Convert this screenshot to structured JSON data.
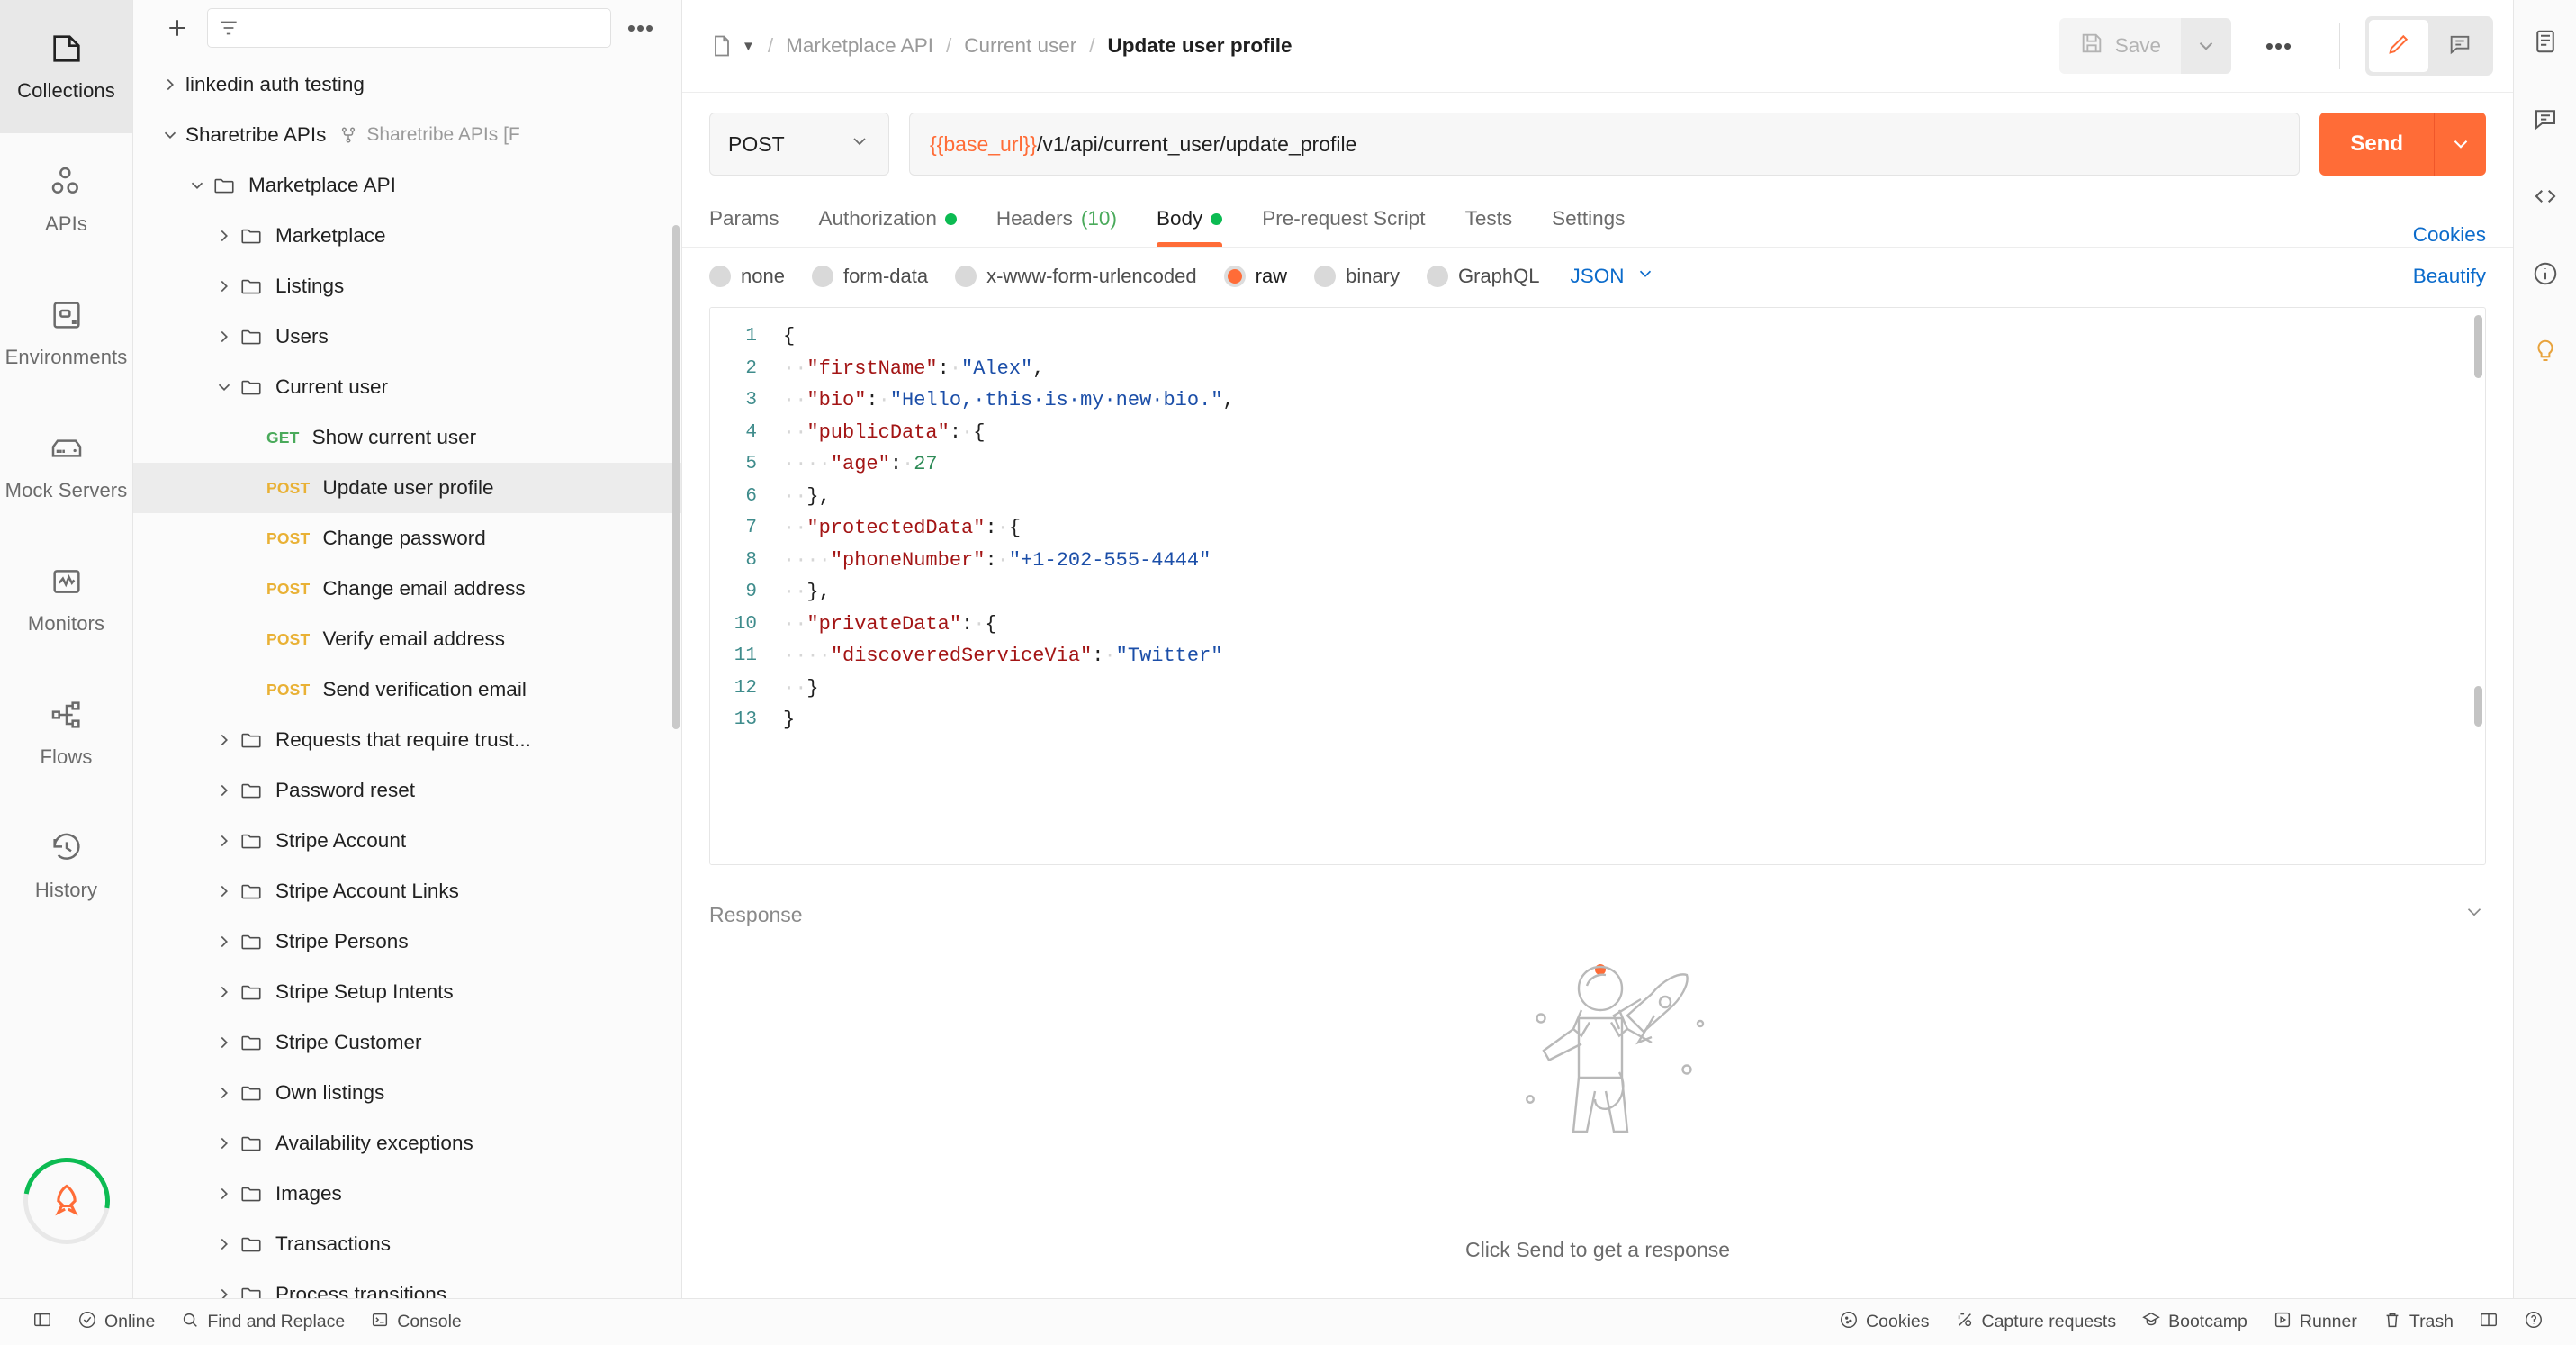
{
  "left_rail": {
    "items": [
      {
        "label": "Collections",
        "icon": "collections-icon",
        "active": true
      },
      {
        "label": "APIs",
        "icon": "apis-icon",
        "active": false
      },
      {
        "label": "Environments",
        "icon": "environments-icon",
        "active": false
      },
      {
        "label": "Mock Servers",
        "icon": "mock-servers-icon",
        "active": false
      },
      {
        "label": "Monitors",
        "icon": "monitors-icon",
        "active": false
      },
      {
        "label": "Flows",
        "icon": "flows-icon",
        "active": false
      },
      {
        "label": "History",
        "icon": "history-icon",
        "active": false
      }
    ],
    "badge_icon": "rocket-icon",
    "badge_ring_color": "#0cbb52"
  },
  "sidebar": {
    "new_button_icon": "plus-icon",
    "filter_icon": "filter-icon",
    "search_placeholder": "",
    "search_value": "",
    "more_icon": "ellipsis-icon",
    "tree": [
      {
        "label": "linkedin auth testing",
        "type": "collection",
        "depth": 0,
        "expanded": false
      },
      {
        "label": "Sharetribe APIs",
        "type": "collection",
        "depth": 0,
        "expanded": true,
        "fork_icon": "fork-icon",
        "fork_label": "Sharetribe APIs [F"
      },
      {
        "label": "Marketplace API",
        "type": "folder",
        "depth": 1,
        "expanded": true
      },
      {
        "label": "Marketplace",
        "type": "folder",
        "depth": 2,
        "expanded": false
      },
      {
        "label": "Listings",
        "type": "folder",
        "depth": 2,
        "expanded": false
      },
      {
        "label": "Users",
        "type": "folder",
        "depth": 2,
        "expanded": false
      },
      {
        "label": "Current user",
        "type": "folder",
        "depth": 2,
        "expanded": true
      },
      {
        "label": "Show current user",
        "type": "request",
        "depth": 3,
        "method": "GET"
      },
      {
        "label": "Update user profile",
        "type": "request",
        "depth": 3,
        "method": "POST",
        "selected": true
      },
      {
        "label": "Change password",
        "type": "request",
        "depth": 3,
        "method": "POST"
      },
      {
        "label": "Change email address",
        "type": "request",
        "depth": 3,
        "method": "POST"
      },
      {
        "label": "Verify email address",
        "type": "request",
        "depth": 3,
        "method": "POST"
      },
      {
        "label": "Send verification email",
        "type": "request",
        "depth": 3,
        "method": "POST"
      },
      {
        "label": "Requests that require trust...",
        "type": "folder",
        "depth": 2,
        "expanded": false
      },
      {
        "label": "Password reset",
        "type": "folder",
        "depth": 2,
        "expanded": false
      },
      {
        "label": "Stripe Account",
        "type": "folder",
        "depth": 2,
        "expanded": false
      },
      {
        "label": "Stripe Account Links",
        "type": "folder",
        "depth": 2,
        "expanded": false
      },
      {
        "label": "Stripe Persons",
        "type": "folder",
        "depth": 2,
        "expanded": false
      },
      {
        "label": "Stripe Setup Intents",
        "type": "folder",
        "depth": 2,
        "expanded": false
      },
      {
        "label": "Stripe Customer",
        "type": "folder",
        "depth": 2,
        "expanded": false
      },
      {
        "label": "Own listings",
        "type": "folder",
        "depth": 2,
        "expanded": false
      },
      {
        "label": "Availability exceptions",
        "type": "folder",
        "depth": 2,
        "expanded": false
      },
      {
        "label": "Images",
        "type": "folder",
        "depth": 2,
        "expanded": false
      },
      {
        "label": "Transactions",
        "type": "folder",
        "depth": 2,
        "expanded": false
      },
      {
        "label": "Process transitions",
        "type": "folder",
        "depth": 2,
        "expanded": false
      }
    ]
  },
  "topbar": {
    "doc_icon": "document-icon",
    "breadcrumb": [
      {
        "label": "Marketplace API",
        "current": false
      },
      {
        "label": "Current user",
        "current": false
      },
      {
        "label": "Update user profile",
        "current": true
      }
    ],
    "separator": "/",
    "save_label": "Save",
    "save_icon": "save-icon",
    "save_caret_icon": "chevron-down-icon",
    "more_icon": "ellipsis-icon",
    "view_buttons": [
      {
        "icon": "pencil-icon",
        "active": true
      },
      {
        "icon": "comment-icon",
        "active": false
      }
    ]
  },
  "request": {
    "method": "POST",
    "url_variable": "{{base_url}}",
    "url_path": "/v1/api/current_user/update_profile",
    "send_label": "Send",
    "send_caret_icon": "chevron-down-icon",
    "accent_color": "#ff6c37"
  },
  "tabs": {
    "items": [
      {
        "label": "Params",
        "active": false,
        "dot": false
      },
      {
        "label": "Authorization",
        "active": false,
        "dot": true
      },
      {
        "label": "Headers",
        "active": false,
        "dot": false,
        "count": "(10)"
      },
      {
        "label": "Body",
        "active": true,
        "dot": true
      },
      {
        "label": "Pre-request Script",
        "active": false,
        "dot": false
      },
      {
        "label": "Tests",
        "active": false,
        "dot": false
      },
      {
        "label": "Settings",
        "active": false,
        "dot": false
      }
    ],
    "cookies_label": "Cookies"
  },
  "body_bar": {
    "options": [
      {
        "label": "none",
        "selected": false
      },
      {
        "label": "form-data",
        "selected": false
      },
      {
        "label": "x-www-form-urlencoded",
        "selected": false
      },
      {
        "label": "raw",
        "selected": true
      },
      {
        "label": "binary",
        "selected": false
      },
      {
        "label": "GraphQL",
        "selected": false
      }
    ],
    "format": "JSON",
    "format_caret_icon": "chevron-down-icon",
    "beautify_label": "Beautify"
  },
  "editor": {
    "line_numbers": [
      "1",
      "2",
      "3",
      "4",
      "5",
      "6",
      "7",
      "8",
      "9",
      "10",
      "11",
      "12",
      "13"
    ],
    "lines": [
      [
        {
          "t": "{",
          "c": "p"
        }
      ],
      [
        {
          "t": "··",
          "c": "ws"
        },
        {
          "t": "\"firstName\"",
          "c": "k"
        },
        {
          "t": ":",
          "c": "p"
        },
        {
          "t": "·",
          "c": "ws"
        },
        {
          "t": "\"Alex\"",
          "c": "s"
        },
        {
          "t": ",",
          "c": "p"
        }
      ],
      [
        {
          "t": "··",
          "c": "ws"
        },
        {
          "t": "\"bio\"",
          "c": "k"
        },
        {
          "t": ":",
          "c": "p"
        },
        {
          "t": "·",
          "c": "ws"
        },
        {
          "t": "\"Hello,·this·is·my·new·bio.\"",
          "c": "s"
        },
        {
          "t": ",",
          "c": "p"
        }
      ],
      [
        {
          "t": "··",
          "c": "ws"
        },
        {
          "t": "\"publicData\"",
          "c": "k"
        },
        {
          "t": ":",
          "c": "p"
        },
        {
          "t": "·",
          "c": "ws"
        },
        {
          "t": "{",
          "c": "p"
        }
      ],
      [
        {
          "t": "····",
          "c": "ws"
        },
        {
          "t": "\"age\"",
          "c": "k"
        },
        {
          "t": ":",
          "c": "p"
        },
        {
          "t": "·",
          "c": "ws"
        },
        {
          "t": "27",
          "c": "n"
        }
      ],
      [
        {
          "t": "··",
          "c": "ws"
        },
        {
          "t": "}",
          "c": "p"
        },
        {
          "t": ",",
          "c": "p"
        }
      ],
      [
        {
          "t": "··",
          "c": "ws"
        },
        {
          "t": "\"protectedData\"",
          "c": "k"
        },
        {
          "t": ":",
          "c": "p"
        },
        {
          "t": "·",
          "c": "ws"
        },
        {
          "t": "{",
          "c": "p"
        }
      ],
      [
        {
          "t": "····",
          "c": "ws"
        },
        {
          "t": "\"phoneNumber\"",
          "c": "k"
        },
        {
          "t": ":",
          "c": "p"
        },
        {
          "t": "·",
          "c": "ws"
        },
        {
          "t": "\"+1-202-555-4444\"",
          "c": "s"
        }
      ],
      [
        {
          "t": "··",
          "c": "ws"
        },
        {
          "t": "}",
          "c": "p"
        },
        {
          "t": ",",
          "c": "p"
        }
      ],
      [
        {
          "t": "··",
          "c": "ws"
        },
        {
          "t": "\"privateData\"",
          "c": "k"
        },
        {
          "t": ":",
          "c": "p"
        },
        {
          "t": "·",
          "c": "ws"
        },
        {
          "t": "{",
          "c": "p"
        }
      ],
      [
        {
          "t": "····",
          "c": "ws"
        },
        {
          "t": "\"discoveredServiceVia\"",
          "c": "k"
        },
        {
          "t": ":",
          "c": "p"
        },
        {
          "t": "·",
          "c": "ws"
        },
        {
          "t": "\"Twitter\"",
          "c": "s"
        }
      ],
      [
        {
          "t": "··",
          "c": "ws"
        },
        {
          "t": "}",
          "c": "p"
        }
      ],
      [
        {
          "t": "}",
          "c": "p"
        }
      ]
    ]
  },
  "response": {
    "title": "Response",
    "collapse_icon": "chevron-down-icon",
    "empty_illustration": "astronaut-rocket-illustration",
    "empty_caption": "Click Send to get a response"
  },
  "right_rail": {
    "buttons": [
      {
        "icon": "documentation-icon"
      },
      {
        "icon": "comment-icon"
      },
      {
        "icon": "code-icon"
      },
      {
        "icon": "info-icon"
      },
      {
        "icon": "lightbulb-icon"
      }
    ]
  },
  "statusbar": {
    "left": [
      {
        "label": "",
        "icon": "sidebar-toggle-icon"
      },
      {
        "label": "Online",
        "icon": "online-icon"
      },
      {
        "label": "Find and Replace",
        "icon": "search-icon"
      },
      {
        "label": "Console",
        "icon": "console-icon"
      }
    ],
    "right": [
      {
        "label": "Cookies",
        "icon": "cookie-icon"
      },
      {
        "label": "Capture requests",
        "icon": "capture-icon"
      },
      {
        "label": "Bootcamp",
        "icon": "bootcamp-icon"
      },
      {
        "label": "Runner",
        "icon": "runner-icon"
      },
      {
        "label": "Trash",
        "icon": "trash-icon"
      },
      {
        "label": "",
        "icon": "layout-icon"
      },
      {
        "label": "",
        "icon": "help-icon"
      }
    ]
  }
}
